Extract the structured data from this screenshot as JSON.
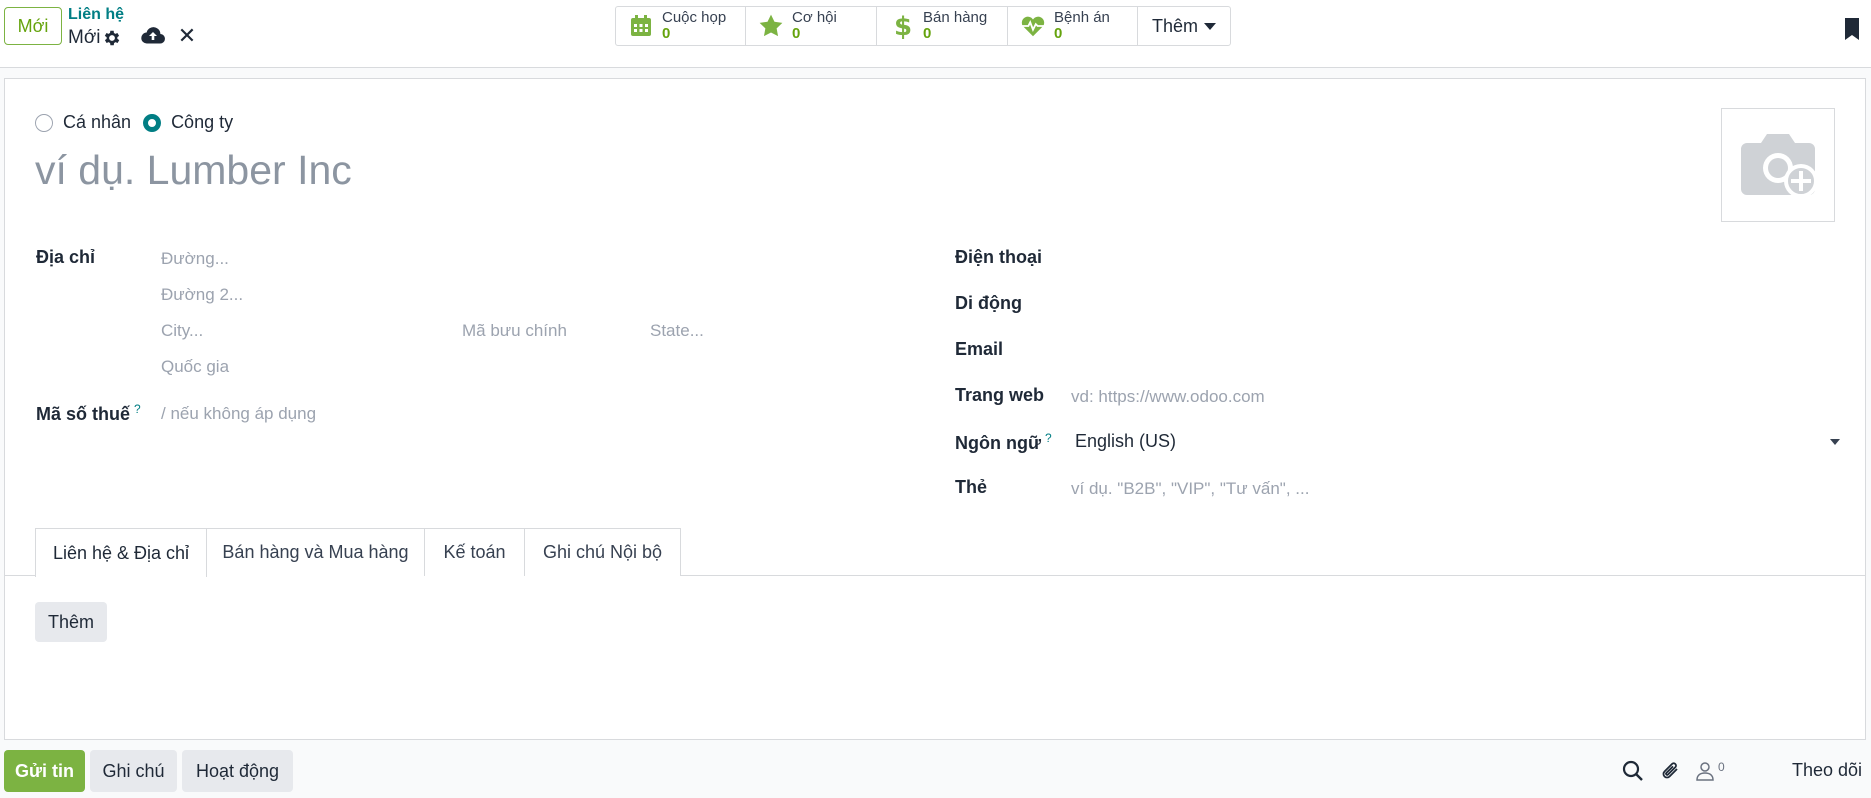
{
  "control_panel": {
    "new_button": "Mới",
    "breadcrumb_parent": "Liên hệ",
    "breadcrumb_current": "Mới",
    "smart_buttons": [
      {
        "label": "Cuộc họp",
        "value": "0",
        "icon": "calendar-icon"
      },
      {
        "label": "Cơ hội",
        "value": "0",
        "icon": "star-icon"
      },
      {
        "label": "Bán hàng",
        "value": "0",
        "icon": "dollar-icon"
      },
      {
        "label": "Bệnh án",
        "value": "0",
        "icon": "heartbeat-icon"
      }
    ],
    "more_label": "Thêm"
  },
  "form": {
    "type_options": [
      "Cá nhân",
      "Công ty"
    ],
    "selected_type": "Công ty",
    "name_placeholder": "ví dụ. Lumber Inc",
    "address": {
      "label": "Địa chỉ",
      "street_placeholder": "Đường...",
      "street2_placeholder": "Đường 2...",
      "city_placeholder": "City...",
      "zip_placeholder": "Mã bưu chính",
      "state_placeholder": "State...",
      "country_placeholder": "Quốc gia"
    },
    "tax": {
      "label": "Mã số thuế",
      "help": "?",
      "placeholder": "/ nếu không áp dụng"
    },
    "phone_label": "Điện thoại",
    "mobile_label": "Di động",
    "email_label": "Email",
    "website": {
      "label": "Trang web",
      "placeholder": "vd: https://www.odoo.com"
    },
    "language": {
      "label": "Ngôn ngữ",
      "help": "?",
      "value": "English (US)"
    },
    "tags": {
      "label": "Thẻ",
      "placeholder": "ví dụ. \"B2B\", \"VIP\", \"Tư vấn\", ..."
    }
  },
  "tabs": [
    "Liên hệ & Địa chỉ",
    "Bán hàng và Mua hàng",
    "Kế toán",
    "Ghi chú Nội bộ"
  ],
  "active_tab": "Liên hệ & Địa chỉ",
  "tab_content": {
    "add_button": "Thêm"
  },
  "chatter": {
    "send_message": "Gửi tin",
    "log_note": "Ghi chú",
    "activity": "Hoạt động",
    "follower_count": "0",
    "follow": "Theo dõi"
  },
  "colors": {
    "primary": "#017e84",
    "accent_green": "#65a30d",
    "button_green": "#7cb342"
  }
}
